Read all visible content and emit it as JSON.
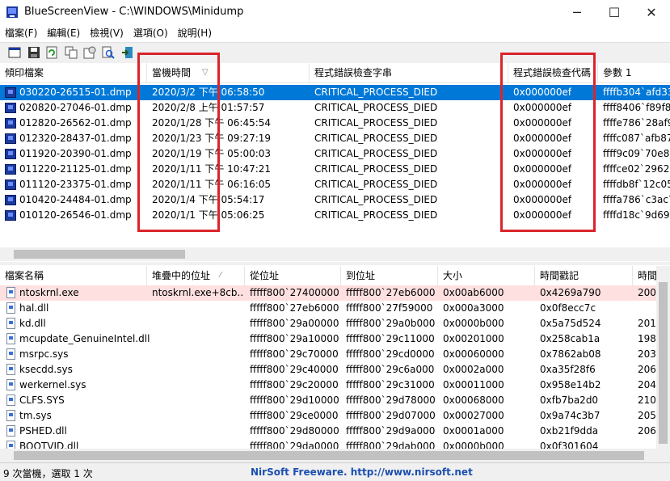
{
  "window": {
    "title": "BlueScreenView  -  C:\\WINDOWS\\Minidump",
    "minimize_glyph": "─",
    "maximize_glyph": "☐",
    "close_glyph": "✕"
  },
  "menu": [
    "檔案(F)",
    "編輯(E)",
    "檢視(V)",
    "選項(O)",
    "說明(H)"
  ],
  "toolbar": [
    "properties-icon",
    "save-icon",
    "refresh-icon",
    "copy-icon",
    "html-report-icon",
    "find-icon",
    "exit-icon"
  ],
  "top_table": {
    "columns": [
      "傾印檔案",
      "當機時間",
      "程式錯誤檢查字串",
      "程式錯誤檢查代碼",
      "參數 1"
    ],
    "sort_indicator": "▽",
    "rows": [
      {
        "file": "030220-26515-01.dmp",
        "time": "2020/3/2 下午 06:58:50",
        "string": "CRITICAL_PROCESS_DIED",
        "code": "0x000000ef",
        "p1": "ffffb304`afd33"
      },
      {
        "file": "020820-27046-01.dmp",
        "time": "2020/2/8 上午 01:57:57",
        "string": "CRITICAL_PROCESS_DIED",
        "code": "0x000000ef",
        "p1": "ffff8406`f89f80"
      },
      {
        "file": "012820-26562-01.dmp",
        "time": "2020/1/28 下午 06:45:54",
        "string": "CRITICAL_PROCESS_DIED",
        "code": "0x000000ef",
        "p1": "ffffe786`28af90"
      },
      {
        "file": "012320-28437-01.dmp",
        "time": "2020/1/23 下午 09:27:19",
        "string": "CRITICAL_PROCESS_DIED",
        "code": "0x000000ef",
        "p1": "ffffc087`afb871"
      },
      {
        "file": "011920-20390-01.dmp",
        "time": "2020/1/19 下午 05:00:03",
        "string": "CRITICAL_PROCESS_DIED",
        "code": "0x000000ef",
        "p1": "ffff9c09`70e8d"
      },
      {
        "file": "011220-21125-01.dmp",
        "time": "2020/1/11 下午 10:47:21",
        "string": "CRITICAL_PROCESS_DIED",
        "code": "0x000000ef",
        "p1": "ffffce02`2962e"
      },
      {
        "file": "011120-23375-01.dmp",
        "time": "2020/1/11 下午 06:16:05",
        "string": "CRITICAL_PROCESS_DIED",
        "code": "0x000000ef",
        "p1": "ffffdb8f`12c052"
      },
      {
        "file": "010420-24484-01.dmp",
        "time": "2020/1/4 下午 05:54:17",
        "string": "CRITICAL_PROCESS_DIED",
        "code": "0x000000ef",
        "p1": "ffffa786`c3ac7"
      },
      {
        "file": "010120-26546-01.dmp",
        "time": "2020/1/1 下午 05:06:25",
        "string": "CRITICAL_PROCESS_DIED",
        "code": "0x000000ef",
        "p1": "ffffd18c`9d692"
      }
    ]
  },
  "bottom_table": {
    "columns": [
      "檔案名稱",
      "堆疊中的位址",
      "從位址",
      "到位址",
      "大小",
      "時間戳記",
      "時間"
    ],
    "sort_indicator": "⁄",
    "rows": [
      {
        "name": "ntoskrnl.exe",
        "stack": "ntoskrnl.exe+8cb...",
        "from": "fffff800`27400000",
        "to": "fffff800`27eb6000",
        "size": "0x00ab6000",
        "ts": "0x4269a790",
        "t": "200"
      },
      {
        "name": "hal.dll",
        "stack": "",
        "from": "fffff800`27eb6000",
        "to": "fffff800`27f59000",
        "size": "0x000a3000",
        "ts": "0x0f8ecc7c",
        "t": ""
      },
      {
        "name": "kd.dll",
        "stack": "",
        "from": "fffff800`29a00000",
        "to": "fffff800`29a0b000",
        "size": "0x0000b000",
        "ts": "0x5a75d524",
        "t": "201"
      },
      {
        "name": "mcupdate_GenuineIntel.dll",
        "stack": "",
        "from": "fffff800`29a10000",
        "to": "fffff800`29c11000",
        "size": "0x00201000",
        "ts": "0x258cab1a",
        "t": "198"
      },
      {
        "name": "msrpc.sys",
        "stack": "",
        "from": "fffff800`29c70000",
        "to": "fffff800`29cd0000",
        "size": "0x00060000",
        "ts": "0x7862ab08",
        "t": "203"
      },
      {
        "name": "ksecdd.sys",
        "stack": "",
        "from": "fffff800`29c40000",
        "to": "fffff800`29c6a000",
        "size": "0x0002a000",
        "ts": "0xa35f28f6",
        "t": "206"
      },
      {
        "name": "werkernel.sys",
        "stack": "",
        "from": "fffff800`29c20000",
        "to": "fffff800`29c31000",
        "size": "0x00011000",
        "ts": "0x958e14b2",
        "t": "204"
      },
      {
        "name": "CLFS.SYS",
        "stack": "",
        "from": "fffff800`29d10000",
        "to": "fffff800`29d78000",
        "size": "0x00068000",
        "ts": "0xfb7ba2d0",
        "t": "210"
      },
      {
        "name": "tm.sys",
        "stack": "",
        "from": "fffff800`29ce0000",
        "to": "fffff800`29d07000",
        "size": "0x00027000",
        "ts": "0x9a74c3b7",
        "t": "205"
      },
      {
        "name": "PSHED.dll",
        "stack": "",
        "from": "fffff800`29d80000",
        "to": "fffff800`29d9a000",
        "size": "0x0001a000",
        "ts": "0xb21f9dda",
        "t": "206"
      },
      {
        "name": "BOOTVID.dll",
        "stack": "",
        "from": "fffff800`29da0000",
        "to": "fffff800`29dab000",
        "size": "0x0000b000",
        "ts": "0x0f301604",
        "t": ""
      }
    ]
  },
  "status": {
    "left": "9 次當機，選取 1 次",
    "center": "NirSoft Freeware.  http://www.nirsoft.net"
  },
  "colors": {
    "selection": "#0078d7",
    "highlight_row": "#ffe0e0",
    "annotation_box": "#d9252b"
  }
}
